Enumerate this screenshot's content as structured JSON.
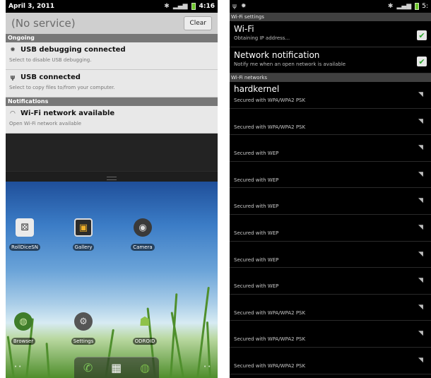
{
  "left": {
    "statusbar": {
      "date": "April 3, 2011",
      "time": "4:16"
    },
    "shade": {
      "title": "(No service)",
      "clear_label": "Clear",
      "ongoing_label": "Ongoing",
      "notifications_label": "Notifications",
      "ongoing": [
        {
          "icon": "usb-debug-icon",
          "title": "USB debugging connected",
          "sub": "Select to disable USB debugging."
        },
        {
          "icon": "usb-icon",
          "title": "USB connected",
          "sub": "Select to copy files to/from your computer."
        }
      ],
      "notifications": [
        {
          "icon": "wifi-icon",
          "title": "Wi-Fi network available",
          "sub": "Open Wi-Fi network available"
        }
      ]
    },
    "home": {
      "apps_row1": [
        "RollDiceSN",
        "Gallery",
        "Camera"
      ],
      "apps_row2": [
        "Browser",
        "Settings",
        "ODROID"
      ]
    }
  },
  "right": {
    "statusbar": {
      "time": "5:"
    },
    "wifi_settings_label": "Wi-Fi settings",
    "wifi": {
      "title": "Wi-Fi",
      "sub": "Obtaining IP address..."
    },
    "network_notification": {
      "title": "Network notification",
      "sub": "Notify me when an open network is available"
    },
    "networks_label": "Wi-Fi networks",
    "networks": [
      {
        "name": "hardkernel",
        "sub": "Secured with WPA/WPA2 PSK"
      },
      {
        "name": "",
        "sub": "Secured with WPA/WPA2 PSK"
      },
      {
        "name": "",
        "sub": "Secured with WEP"
      },
      {
        "name": "",
        "sub": "Secured with WEP"
      },
      {
        "name": "",
        "sub": "Secured with WEP"
      },
      {
        "name": "",
        "sub": "Secured with WEP"
      },
      {
        "name": "",
        "sub": "Secured with WEP"
      },
      {
        "name": "",
        "sub": "Secured with WEP"
      },
      {
        "name": "",
        "sub": "Secured with WPA/WPA2 PSK"
      },
      {
        "name": "",
        "sub": "Secured with WPA/WPA2 PSK"
      },
      {
        "name": "",
        "sub": "Secured with WPA/WPA2 PSK"
      }
    ]
  }
}
